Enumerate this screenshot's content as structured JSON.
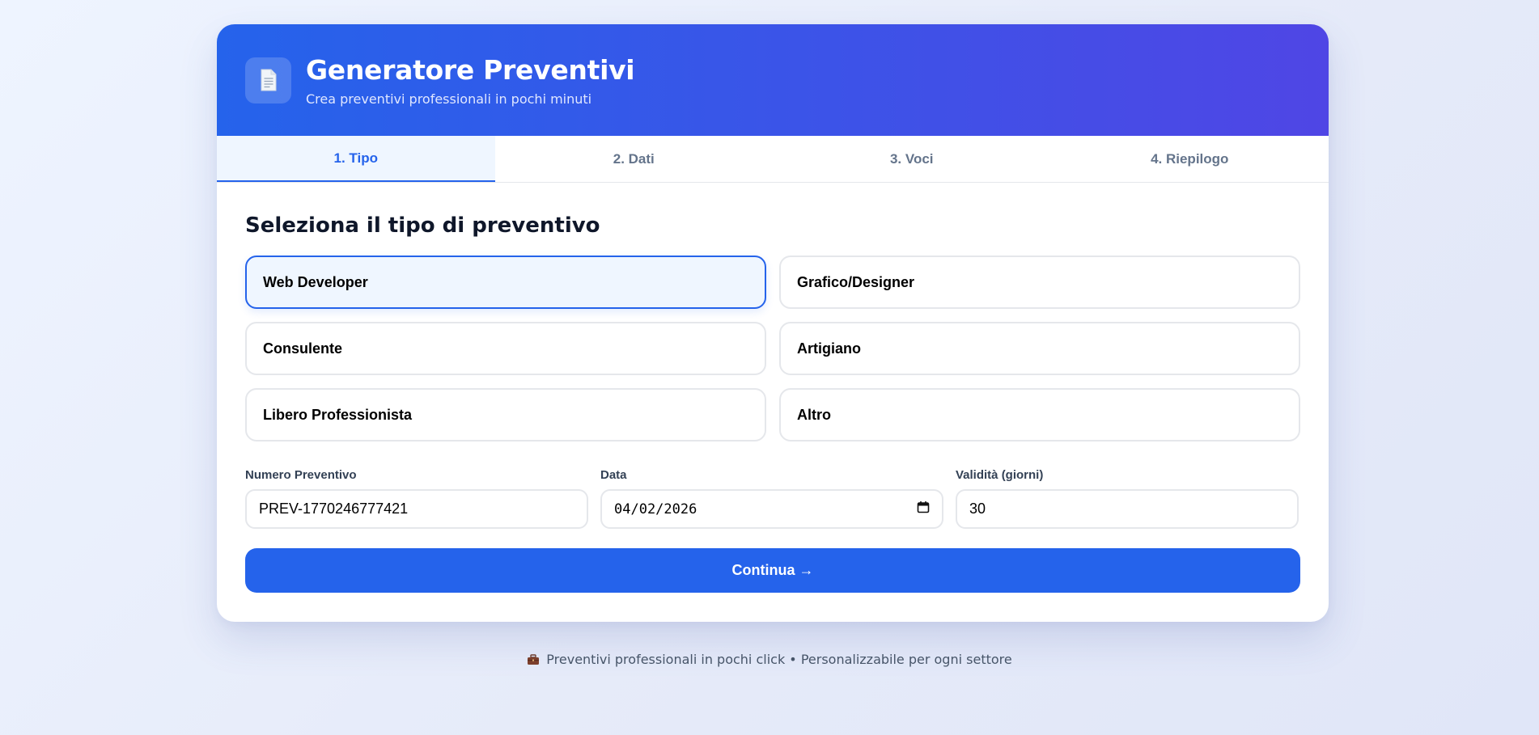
{
  "header": {
    "icon": "document-icon",
    "title": "Generatore Preventivi",
    "subtitle": "Crea preventivi professionali in pochi minuti"
  },
  "tabs": [
    {
      "label": "1. Tipo",
      "active": true
    },
    {
      "label": "2. Dati",
      "active": false
    },
    {
      "label": "3. Voci",
      "active": false
    },
    {
      "label": "4. Riepilogo",
      "active": false
    }
  ],
  "section_title": "Seleziona il tipo di preventivo",
  "types": [
    {
      "label": "Web Developer",
      "selected": true
    },
    {
      "label": "Grafico/Designer",
      "selected": false
    },
    {
      "label": "Consulente",
      "selected": false
    },
    {
      "label": "Artigiano",
      "selected": false
    },
    {
      "label": "Libero Professionista",
      "selected": false
    },
    {
      "label": "Altro",
      "selected": false
    }
  ],
  "fields": {
    "numero": {
      "label": "Numero Preventivo",
      "value": "PREV-1770246777421"
    },
    "data": {
      "label": "Data",
      "value": "04/02/2026"
    },
    "validita": {
      "label": "Validità (giorni)",
      "value": "30"
    }
  },
  "continue_label": "Continua →",
  "footer": {
    "icon": "briefcase-icon",
    "text": "Preventivi professionali in pochi click • Personalizzabile per ogni settore"
  },
  "colors": {
    "primary": "#2563eb",
    "header_gradient_end": "#4f46e5",
    "selected_bg": "#eff6ff"
  }
}
